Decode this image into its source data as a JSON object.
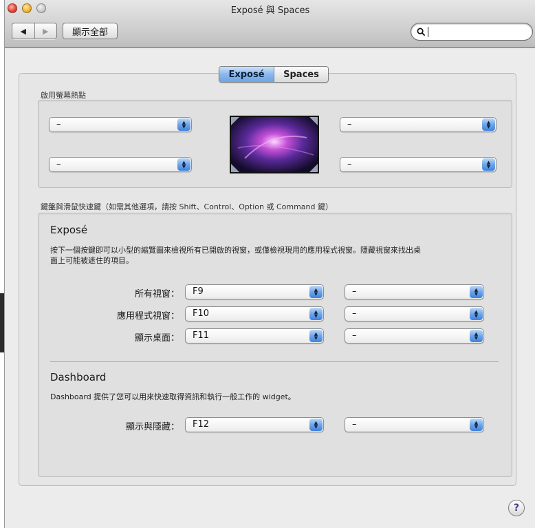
{
  "window": {
    "title": "Exposé 與 Spaces"
  },
  "toolbar": {
    "back_glyph": "◀",
    "forward_glyph": "▶",
    "show_all_label": "顯示全部",
    "search": {
      "value": "",
      "placeholder": ""
    }
  },
  "tabs": [
    {
      "label": "Exposé",
      "selected": true
    },
    {
      "label": "Spaces",
      "selected": false
    }
  ],
  "hot_corners": {
    "label": "啟用螢幕熱點",
    "top_left": "–",
    "bottom_left": "–",
    "top_right": "–",
    "bottom_right": "–"
  },
  "shortcuts": {
    "label": "鍵盤與滑鼠快速鍵（如需其他選項，請按 Shift、Control、Option 或 Command 鍵）",
    "expose": {
      "heading": "Exposé",
      "description_line1": "按下一個按鍵即可以小型的縮覽圖來檢視所有已開啟的視窗，或僅檢視現用的應用程式視窗。隱藏視窗來找出桌",
      "description_line2": "面上可能被遮住的項目。",
      "rows": [
        {
          "label": "所有視窗：",
          "key": "F9",
          "mouse": "–"
        },
        {
          "label": "應用程式視窗：",
          "key": "F10",
          "mouse": "–"
        },
        {
          "label": "顯示桌面：",
          "key": "F11",
          "mouse": "–"
        }
      ]
    },
    "dashboard": {
      "heading": "Dashboard",
      "description": "Dashboard 提供了您可以用來快速取得資訊和執行一般工作的 widget。",
      "row": {
        "label": "顯示與隱藏：",
        "key": "F12",
        "mouse": "–"
      }
    }
  },
  "help": {
    "glyph": "?"
  },
  "colors": {
    "window_bg": "#ececec",
    "accent_blue": "#6fa5e8",
    "tab_active": "#8ab8ec"
  }
}
